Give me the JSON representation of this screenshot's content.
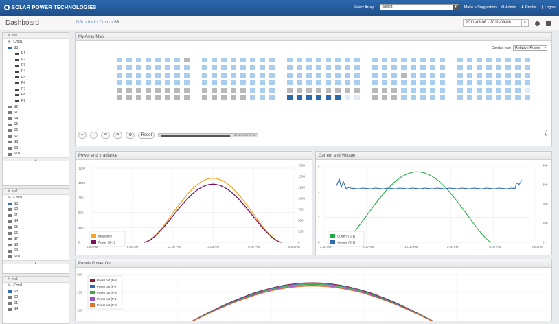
{
  "header": {
    "brand": "SOLAR POWER TECHNOLOGIES",
    "select_label": "Select Array:",
    "select_value": "-Select-",
    "suggestion": "Make a Suggestion",
    "admin": "Admin",
    "profile": "Profile",
    "logout": "Logout"
  },
  "subbar": {
    "title": "Dashboard",
    "crumbs": [
      "DSL",
      "Inv1",
      "Cmb1",
      "S3"
    ],
    "date_range": "2011-09-06 - 2011-09-06"
  },
  "sidebar": {
    "trees": [
      {
        "head": "Inv1",
        "cmb": "Cmb1",
        "items": [
          "S3",
          "P1",
          "P2",
          "P3",
          "P4",
          "P5",
          "P6",
          "P7",
          "P8",
          "P9",
          "S2",
          "S1",
          "S4",
          "S5",
          "S6",
          "S7",
          "S8",
          "S9",
          "S10"
        ]
      },
      {
        "head": "Inv1",
        "cmb": "Cmb1",
        "items": [
          "S3",
          "S2",
          "S1",
          "S4",
          "S5",
          "S6",
          "S7",
          "S8",
          "S9",
          "S10"
        ]
      },
      {
        "head": "Inv1",
        "cmb": "Cmb1",
        "items": [
          "S3",
          "S2",
          "S1",
          "S4"
        ]
      }
    ]
  },
  "array_map": {
    "title": "My Array Map",
    "overlay_label": "Overlay type",
    "overlay_value": "Relative Power",
    "reset": "Reset",
    "timestamp": "2011-09-07 07:15",
    "north": "N"
  },
  "power_chart": {
    "title": "Power and Irradiance",
    "legend": [
      "Irradiance",
      "Power (S-1)"
    ]
  },
  "cv_chart": {
    "title": "Current and Voltage",
    "legend": [
      "Current (S-1)",
      "Voltage (S-1)"
    ]
  },
  "panels_chart": {
    "title": "Panels Power Out",
    "legend": [
      "Power out (P-8)",
      "Power out (P-7)",
      "Power out (P-6)",
      "Power out (P-1)",
      "Power out (P-9)"
    ]
  },
  "chart_data": [
    {
      "type": "line",
      "title": "Power and Irradiance",
      "x_ticks": [
        "6:00 AM",
        "9:00 AM",
        "12:00 PM",
        "3:00 PM",
        "6:00 PM",
        "9:00 PM"
      ],
      "y_left_ticks": [
        0,
        250,
        500,
        750,
        1000,
        1250
      ],
      "y_right_ticks": [
        0,
        250,
        500,
        750,
        1000,
        1250,
        1500,
        1750
      ],
      "series": [
        {
          "name": "Irradiance",
          "color": "#f5a623",
          "peak": 1080
        },
        {
          "name": "Power (S-1)",
          "color": "#7a1060",
          "peak": 980
        }
      ]
    },
    {
      "type": "line",
      "title": "Current and Voltage",
      "x_ticks": [
        "2:00 AM",
        "9:00 AM",
        "12:00 PM",
        "3:00 PM",
        "6:00 PM",
        "9:00 PM"
      ],
      "y_left_ticks": [
        0,
        2,
        4,
        6
      ],
      "y_right_ticks": [
        0,
        100,
        200,
        300,
        400
      ],
      "series": [
        {
          "name": "Current (S-1)",
          "color": "#22aa44",
          "peak": 5.6
        },
        {
          "name": "Voltage (S-1)",
          "color": "#2f6bb5",
          "level": 280
        }
      ]
    },
    {
      "type": "line",
      "title": "Panels Power Out",
      "y_ticks": [
        100,
        150,
        200
      ],
      "series": [
        {
          "name": "Power out (P-8)",
          "color": "#8b1a3a"
        },
        {
          "name": "Power out (P-7)",
          "color": "#2f6bb5"
        },
        {
          "name": "Power out (P-6)",
          "color": "#3aa845"
        },
        {
          "name": "Power out (P-1)",
          "color": "#9a4ec0"
        },
        {
          "name": "Power out (P-9)",
          "color": "#e0702a"
        }
      ]
    }
  ]
}
